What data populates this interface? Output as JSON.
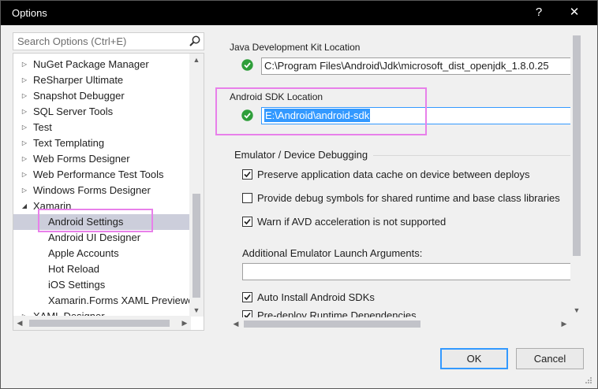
{
  "window": {
    "title": "Options",
    "help_glyph": "?",
    "close_glyph": "✕"
  },
  "search": {
    "placeholder": "Search Options (Ctrl+E)"
  },
  "tree": {
    "items": [
      {
        "label": "NuGet Package Manager",
        "expandable": true
      },
      {
        "label": "ReSharper Ultimate",
        "expandable": true
      },
      {
        "label": "Snapshot Debugger",
        "expandable": true
      },
      {
        "label": "SQL Server Tools",
        "expandable": true
      },
      {
        "label": "Test",
        "expandable": true
      },
      {
        "label": "Text Templating",
        "expandable": true
      },
      {
        "label": "Web Forms Designer",
        "expandable": true
      },
      {
        "label": "Web Performance Test Tools",
        "expandable": true
      },
      {
        "label": "Windows Forms Designer",
        "expandable": true
      },
      {
        "label": "Xamarin",
        "expanded": true
      },
      {
        "label": "Android Settings",
        "child": true,
        "selected": true
      },
      {
        "label": "Android UI Designer",
        "child": true
      },
      {
        "label": "Apple Accounts",
        "child": true
      },
      {
        "label": "Hot Reload",
        "child": true
      },
      {
        "label": "iOS Settings",
        "child": true
      },
      {
        "label": "Xamarin.Forms XAML Previewer",
        "child": true
      },
      {
        "label": "XAML Designer",
        "expandable": true
      }
    ]
  },
  "jdk": {
    "label": "Java Development Kit Location",
    "value": "C:\\Program Files\\Android\\Jdk\\microsoft_dist_openjdk_1.8.0.25"
  },
  "sdk": {
    "label": "Android SDK Location",
    "value": "E:\\Android\\android-sdk"
  },
  "emulator": {
    "title": "Emulator / Device Debugging",
    "options": [
      {
        "label": "Preserve application data cache on device between deploys",
        "checked": true
      },
      {
        "label": "Provide debug symbols for shared runtime and base class libraries",
        "checked": false
      },
      {
        "label": "Warn if AVD acceleration is not supported",
        "checked": true
      }
    ],
    "args_label": "Additional Emulator Launch Arguments:",
    "args_value": ""
  },
  "more_options": [
    {
      "label": "Auto Install Android SDKs",
      "checked": true
    },
    {
      "label": "Pre-deploy Runtime Dependencies",
      "checked": true
    }
  ],
  "buttons": {
    "ok": "OK",
    "cancel": "Cancel"
  },
  "colors": {
    "accent": "#3399ff",
    "highlight": "#e880ea",
    "success": "#2e9e3a"
  }
}
